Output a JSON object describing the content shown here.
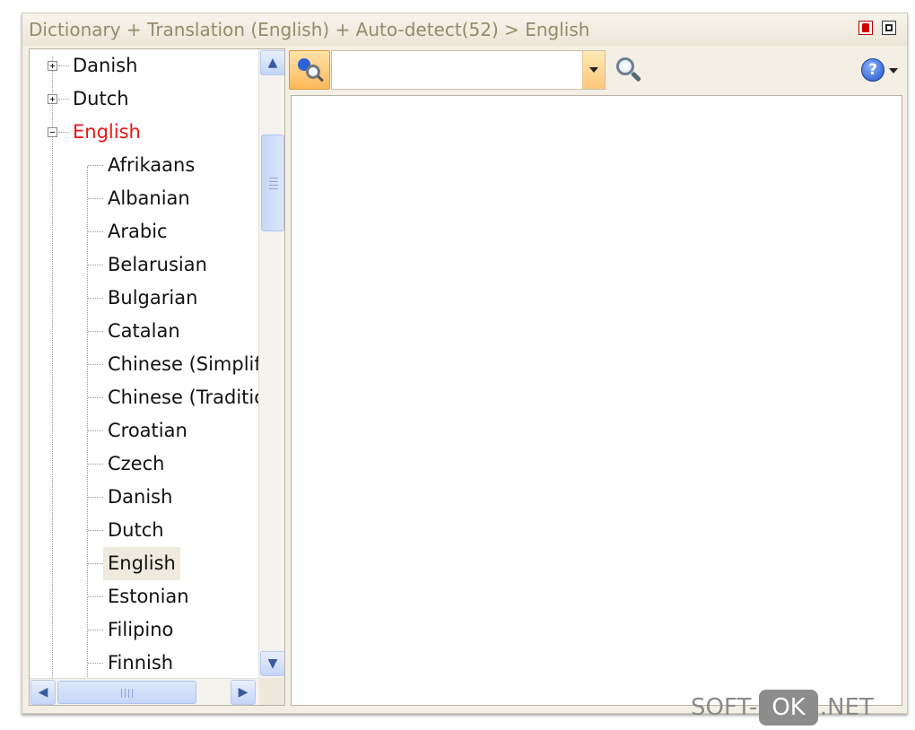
{
  "window": {
    "title": "Dictionary + Translation (English) + Auto-detect(52) > English"
  },
  "tree": {
    "top_items": [
      {
        "label": "Danish",
        "expanded": false
      },
      {
        "label": "Dutch",
        "expanded": false
      },
      {
        "label": "English",
        "expanded": true
      }
    ],
    "children": [
      "Afrikaans",
      "Albanian",
      "Arabic",
      "Belarusian",
      "Bulgarian",
      "Catalan",
      "Chinese (Simplific",
      "Chinese (Traditio",
      "Croatian",
      "Czech",
      "Danish",
      "Dutch",
      "English",
      "Estonian",
      "Filipino",
      "Finnish"
    ],
    "selected_child": "English"
  },
  "toolbar": {
    "search_value": "",
    "icons": {
      "source": "source-search-icon",
      "search": "magnifier-icon",
      "help": "help-icon"
    },
    "help_glyph": "?"
  },
  "colors": {
    "expanded_label": "#f01414",
    "title_text": "#958a6c",
    "accent_orange": "#fcb85a",
    "scrollbar_blue": "#c7d7f8"
  },
  "watermark": {
    "left": "SOFT-",
    "pill": "OK",
    "right": ".NET"
  }
}
